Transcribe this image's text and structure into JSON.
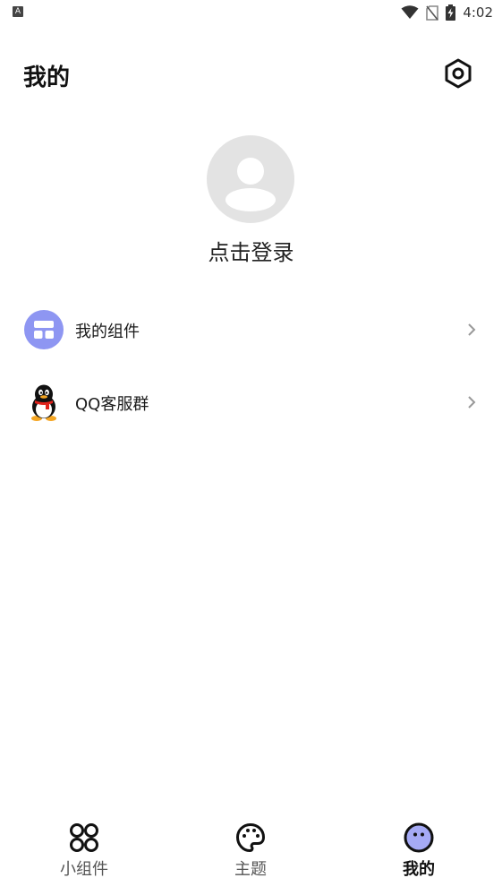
{
  "status_bar": {
    "left_icon": "A",
    "time": "4:02",
    "icons": [
      "wifi-icon",
      "no-sim-icon",
      "battery-charging-icon"
    ]
  },
  "header": {
    "title": "我的",
    "settings_icon": "settings-hexagon-icon"
  },
  "profile": {
    "login_label": "点击登录",
    "avatar_icon": "default-user-avatar-icon"
  },
  "menu": {
    "items": [
      {
        "label": "我的组件",
        "icon": "widgets-icon",
        "icon_color": "#8e96f2"
      },
      {
        "label": "QQ客服群",
        "icon": "qq-penguin-icon"
      }
    ],
    "chevron_icon": "chevron-right-icon"
  },
  "bottom_nav": {
    "items": [
      {
        "label": "小组件",
        "icon": "grid-four-circles-icon",
        "active": false
      },
      {
        "label": "主题",
        "icon": "palette-icon",
        "active": false
      },
      {
        "label": "我的",
        "icon": "face-icon",
        "active": true
      }
    ],
    "active_color": "#a5aaf5"
  },
  "colors": {
    "background": "#ffffff",
    "accent": "#8e96f2",
    "avatar_bg": "#e3e3e3"
  }
}
